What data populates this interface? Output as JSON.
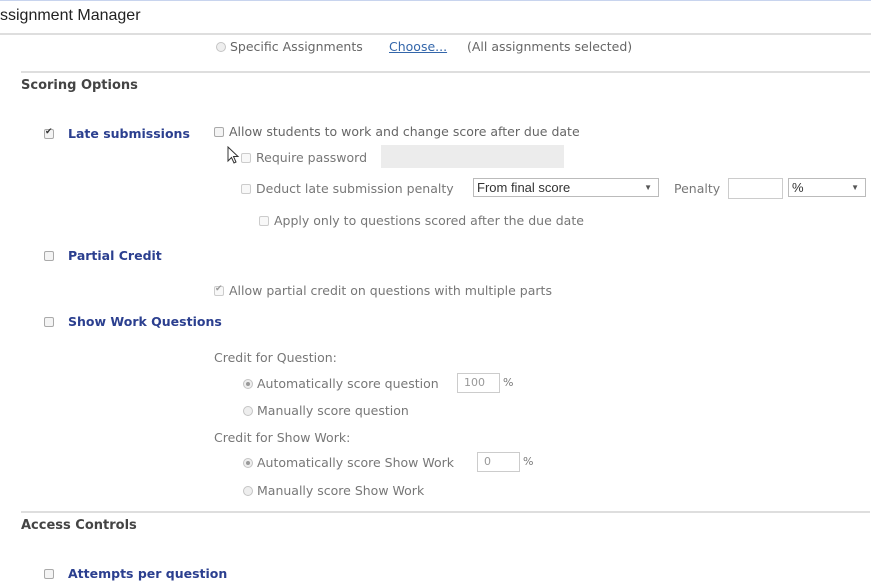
{
  "header": {
    "title": "ssignment Manager"
  },
  "assignments": {
    "specific_label": "Specific Assignments",
    "choose_link": "Choose...",
    "selection_note": "(All assignments selected)"
  },
  "scoring": {
    "heading": "Scoring Options",
    "late": {
      "label": "Late submissions",
      "checked": true,
      "allow_label": "Allow students to work and change score after due date",
      "require_password_label": "Require password",
      "deduct_label": "Deduct late submission penalty",
      "deduct_select": "From final score",
      "penalty_label": "Penalty",
      "penalty_value": "",
      "penalty_unit": "%",
      "apply_only_label": "Apply only to questions scored after the due date"
    },
    "partial": {
      "label": "Partial Credit",
      "checked": false,
      "allow_multi_label": "Allow partial credit on questions with multiple parts"
    },
    "show_work": {
      "label": "Show Work Questions",
      "checked": false,
      "credit_question_label": "Credit for Question:",
      "auto_question_label": "Automatically score question",
      "auto_question_value": "100",
      "percent": "%",
      "manual_question_label": "Manually score question",
      "credit_work_label": "Credit for Show Work:",
      "auto_work_label": "Automatically score Show Work",
      "auto_work_value": "0",
      "manual_work_label": "Manually score Show Work"
    }
  },
  "access": {
    "heading": "Access Controls",
    "attempts_label": "Attempts per question"
  }
}
